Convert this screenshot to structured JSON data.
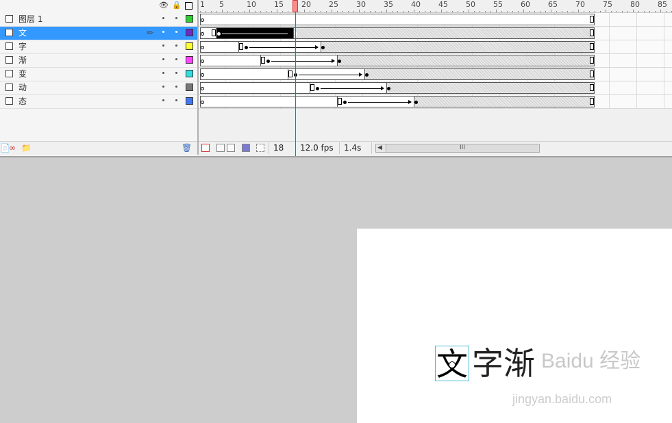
{
  "layers": [
    {
      "name": "图层 1",
      "color": "#33cc33",
      "selected": false
    },
    {
      "name": "文",
      "color": "#6a2cc2",
      "selected": true
    },
    {
      "name": "字",
      "color": "#ffff33",
      "selected": false
    },
    {
      "name": "渐",
      "color": "#ff44ff",
      "selected": false
    },
    {
      "name": "变",
      "color": "#33dddd",
      "selected": false
    },
    {
      "name": "动",
      "color": "#777777",
      "selected": false
    },
    {
      "name": "态",
      "color": "#4477ee",
      "selected": false
    }
  ],
  "header_icons": [
    "eye-icon",
    "lock-icon",
    "outline-icon"
  ],
  "ruler_labels": [
    "1",
    "5",
    "10",
    "15",
    "20",
    "25",
    "30",
    "35",
    "40",
    "45",
    "50",
    "55",
    "60",
    "65",
    "70",
    "75",
    "80",
    "85"
  ],
  "status": {
    "current_frame": "18",
    "fps": "12.0 fps",
    "elapsed": "1.4s",
    "scroll_grip": "III"
  },
  "stage": {
    "text_selected": "文",
    "text_rest": "字渐",
    "watermark": "Baidu 经验",
    "watermark_url": "jingyan.baidu.com"
  }
}
